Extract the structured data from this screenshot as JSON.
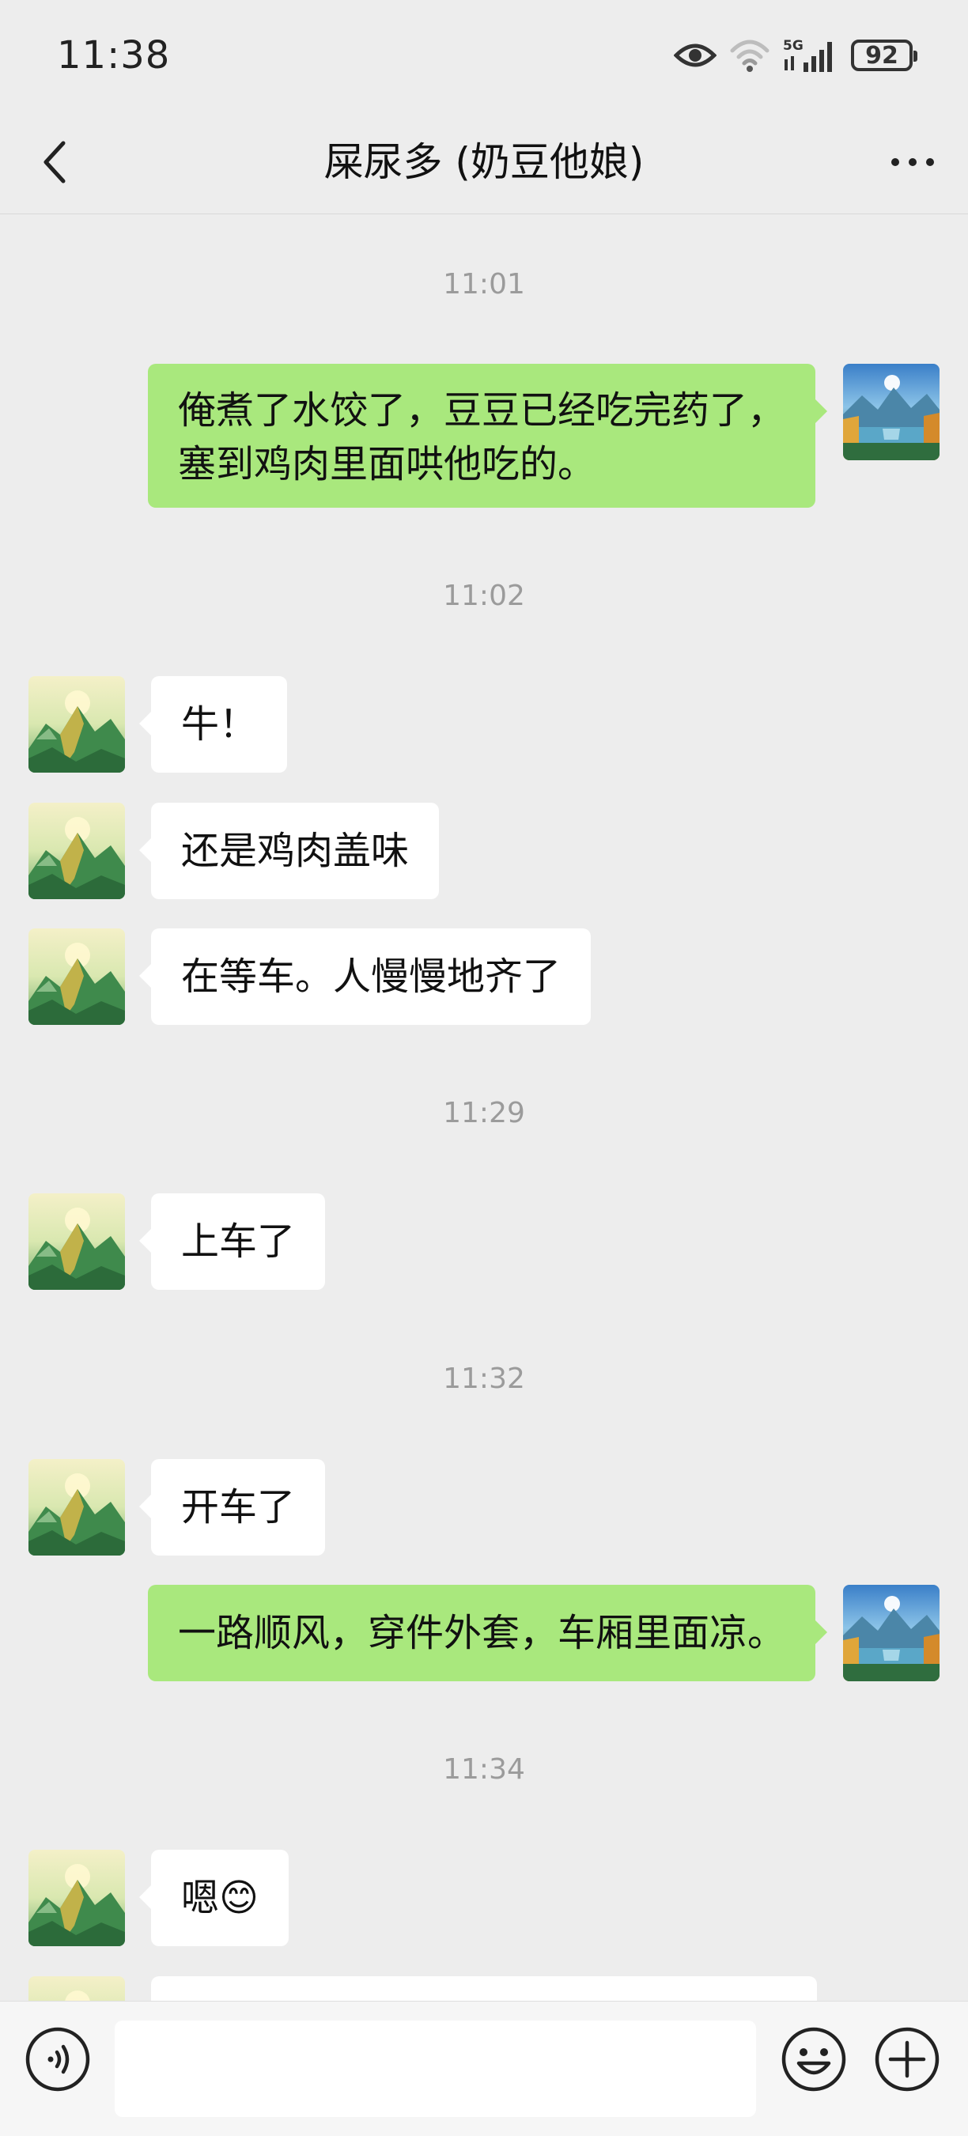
{
  "status_bar": {
    "time": "11:38",
    "network": "5G",
    "battery": "92",
    "icons": [
      "eye-icon",
      "wifi-icon",
      "signal-icon",
      "battery-icon"
    ]
  },
  "header": {
    "title": "屎尿多 (奶豆他娘)",
    "back_icon": "chevron-left-icon",
    "more_icon": "more-dots-icon"
  },
  "messages": [
    {
      "type": "timestamp",
      "text": "11:01"
    },
    {
      "type": "sent",
      "lines": [
        "俺煮了水饺了，豆豆已经吃完药了，",
        "塞到鸡肉里面哄他吃的。"
      ]
    },
    {
      "type": "timestamp",
      "text": "11:02"
    },
    {
      "type": "received",
      "text": "牛！"
    },
    {
      "type": "received",
      "text": "还是鸡肉盖味"
    },
    {
      "type": "received",
      "text": "在等车。人慢慢地齐了"
    },
    {
      "type": "timestamp",
      "text": "11:29"
    },
    {
      "type": "received",
      "text": "上车了"
    },
    {
      "type": "timestamp",
      "text": "11:32"
    },
    {
      "type": "received",
      "text": "开车了"
    },
    {
      "type": "sent",
      "text": "一路顺风，穿件外套，车厢里面凉。"
    },
    {
      "type": "timestamp",
      "text": "11:34"
    },
    {
      "type": "received",
      "text": "嗯😊"
    }
  ],
  "input_bar": {
    "value": "",
    "icons": [
      "voice-icon",
      "emoji-icon",
      "plus-icon"
    ]
  },
  "colors": {
    "background": "#ededed",
    "sent_bubble": "#a9e87d",
    "received_bubble": "#ffffff",
    "timestamp": "#9b9b9b"
  }
}
